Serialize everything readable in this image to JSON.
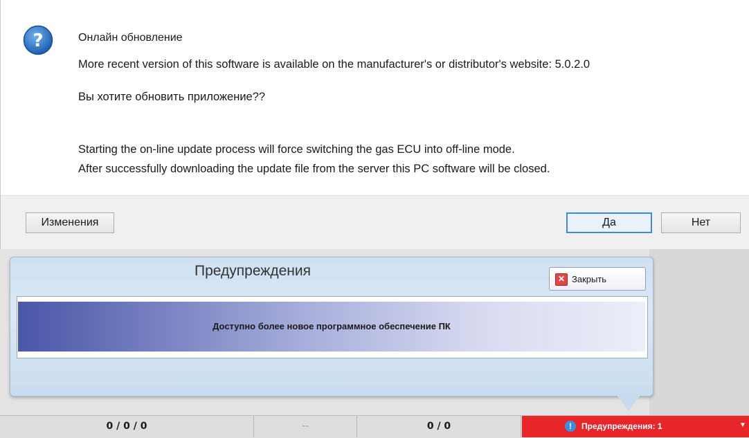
{
  "dialog": {
    "title": "Онлайн обновление",
    "message_version": "More recent version of this software is available on the manufacturer's or distributor's website: 5.0.2.0",
    "question": "Вы хотите обновить приложение??",
    "info_line1": "Starting the on-line update process will force switching the gas ECU into off-line mode.",
    "info_line2": "After successfully downloading the update file from the server this PC software will be closed.",
    "buttons": {
      "changes": "Изменения",
      "yes": "Да",
      "no": "Нет"
    },
    "icon": "question-icon"
  },
  "warnings_panel": {
    "title": "Предупреждения",
    "close_label": "Закрыть",
    "message": "Доступно более новое программное обеспечение ПК",
    "close_icon": "close-icon"
  },
  "statusbar": {
    "cell1": "0 / 0 / 0",
    "cell2": "--",
    "cell3": "0 / 0",
    "warnings": "Предупреждения: 1",
    "warnings_icon": "alert-icon",
    "warnings_color": "#e8262a"
  }
}
